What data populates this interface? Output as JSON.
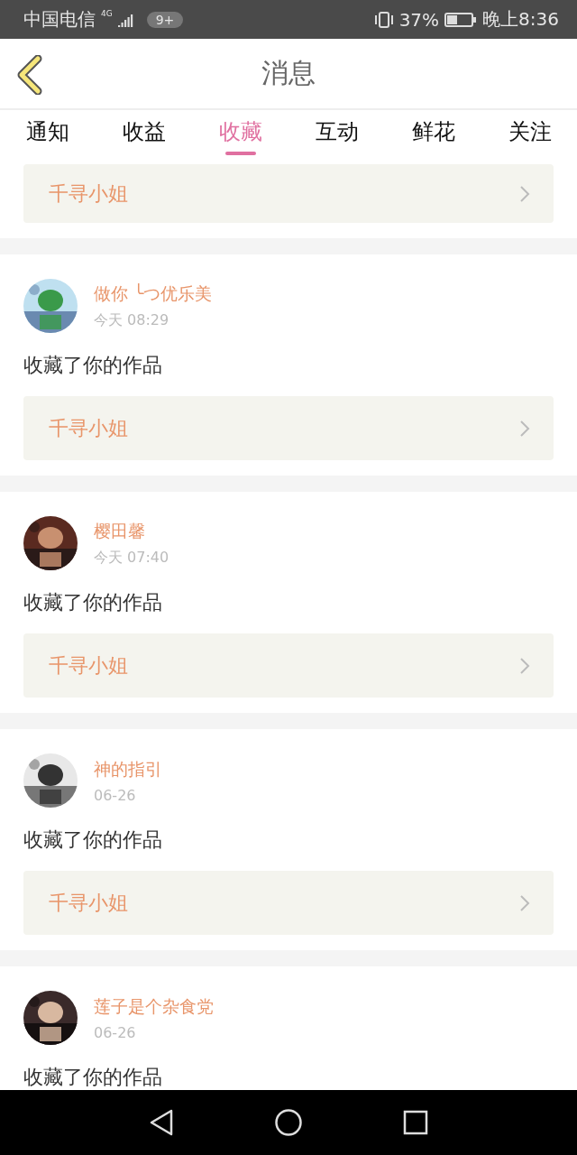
{
  "status_bar": {
    "carrier": "中国电信",
    "network": "4G",
    "badge": "9+",
    "battery": "37%",
    "time": "晚上8:36"
  },
  "header": {
    "title": "消息"
  },
  "tabs": [
    {
      "label": "通知",
      "selected": false
    },
    {
      "label": "收益",
      "selected": false
    },
    {
      "label": "收藏",
      "selected": true
    },
    {
      "label": "互动",
      "selected": false
    },
    {
      "label": "鲜花",
      "selected": false
    },
    {
      "label": "关注",
      "selected": false
    }
  ],
  "partial_work": "千寻小姐",
  "messages": [
    {
      "user": "做你 ╰つ优乐美",
      "time": "今天 08:29",
      "text": "收藏了你的作品",
      "work": "千寻小姐"
    },
    {
      "user": "樱田馨",
      "time": "今天 07:40",
      "text": "收藏了你的作品",
      "work": "千寻小姐"
    },
    {
      "user": "神的指引",
      "time": "06-26",
      "text": "收藏了你的作品",
      "work": "千寻小姐"
    },
    {
      "user": "莲子是个杂食党",
      "time": "06-26",
      "text": "收藏了你的作品"
    }
  ]
}
